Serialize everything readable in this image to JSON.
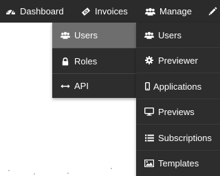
{
  "navbar": {
    "items": [
      {
        "label": "Dashboard",
        "icon": "dashboard-icon"
      },
      {
        "label": "Invoices",
        "icon": "ticket-icon"
      },
      {
        "label": "Manage",
        "icon": "users-icon"
      },
      {
        "label": "",
        "icon": "pencil-icon"
      }
    ]
  },
  "submenu": {
    "items": [
      {
        "label": "Users",
        "icon": "users-icon",
        "active": true
      },
      {
        "label": "Roles",
        "icon": "lock-icon"
      },
      {
        "label": "API",
        "icon": "arrows-horizontal-icon"
      }
    ]
  },
  "manage_menu": {
    "items": [
      {
        "label": "Users",
        "icon": "users-icon"
      },
      {
        "label": "Previewer",
        "icon": "gear-icon"
      },
      {
        "label": "Applications",
        "icon": "mobile-icon"
      },
      {
        "label": "Previews",
        "icon": "monitor-icon"
      },
      {
        "label": "Subscriptions",
        "icon": "list-icon"
      },
      {
        "label": "Templates",
        "icon": "image-icon"
      }
    ]
  },
  "colors": {
    "navbar_bg": "#2b2b2b",
    "menu_bg": "#2d2d2d",
    "active_bg": "#6e6e6e",
    "text": "#ffffff"
  }
}
